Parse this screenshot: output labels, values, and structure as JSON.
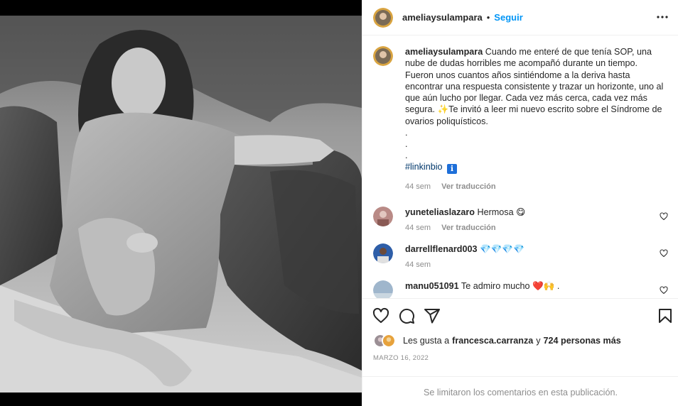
{
  "post": {
    "username": "ameliaysulampara",
    "dot": "•",
    "follow_label": "Seguir",
    "caption_lines": [
      "Cuando me enteré de que tenía SOP, una",
      "nube de dudas horribles me acompañó durante un tiempo.",
      "Fueron unos cuantos años sintiéndome a la deriva hasta",
      "encontrar una respuesta consistente y trazar un horizonte, uno al",
      "que aún lucho por llegar. Cada vez más cerca, cada vez más",
      "segura. ✨Te invitó a leer mi nuevo escrito sobre el Síndrome de",
      "ovarios poliquísticos."
    ],
    "dots": [
      ".",
      ".",
      "."
    ],
    "hashtag": "#linkinbio",
    "info_emoji": "ℹ",
    "caption_time": "44 sem",
    "translate_label": "Ver traducción"
  },
  "comments": [
    {
      "username": "yuneteliaslazaro",
      "text": "Hermosa 😋",
      "time": "44 sem",
      "translate": "Ver traducción"
    },
    {
      "username": "darrellflenard003",
      "text": "💎💎💎💎",
      "time": "44 sem"
    },
    {
      "username": "manu051091",
      "text": "Te admiro mucho ❤️🙌 ."
    }
  ],
  "likes": {
    "prefix": "Les gusta a",
    "user": "francesca.carranza",
    "and": "y",
    "count_text": "724 personas más"
  },
  "date": "MARZO 16, 2022",
  "footer_text": "Se limitaron los comentarios en esta publicación.",
  "icons": [
    "more-icon",
    "heart-icon",
    "comment-icon",
    "share-icon",
    "bookmark-icon"
  ],
  "colors": {
    "follow": "#0095f6",
    "hashtag": "#00376b",
    "muted": "#8e8e8e"
  }
}
